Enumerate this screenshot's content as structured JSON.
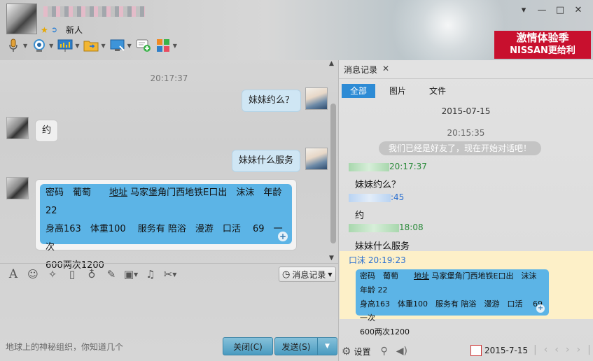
{
  "header": {
    "nickname": "",
    "signature": "新人",
    "window_controls": [
      "▾",
      "—",
      "□",
      "✕"
    ]
  },
  "ad": {
    "line1": "激情体验季",
    "line2": "NISSAN更给利"
  },
  "chat": {
    "timestamp": "20:17:37",
    "messages": [
      {
        "side": "me",
        "text": "妹妹约么？"
      },
      {
        "side": "them",
        "text": "约"
      },
      {
        "side": "me",
        "text": "妹妹什么服务"
      }
    ],
    "card": {
      "line1_a": "密码　葡萄　　",
      "line1_link": "地址",
      "line1_b": " 马家堡角门西地铁E口出　沫沫　年龄 22",
      "line2": "身高163　体重100　 服务有 陪浴　漫游　口活　 69　一次",
      "line3": "600两次1200"
    }
  },
  "input": {
    "history_button": "消息记录",
    "placeholder": "地球上的神秘组织，你知道几个",
    "close_button": "关闭(C)",
    "send_button": "发送(S)"
  },
  "history": {
    "tab_title": "消息记录",
    "filters": [
      "全部",
      "图片",
      "文件"
    ],
    "date": "2015-07-15",
    "time": "20:15:35",
    "system_message": "我们已经是好友了，现在开始对话吧！",
    "entries": [
      {
        "sender_time": "20:17:37",
        "text": "妹妹约么？"
      },
      {
        "sender_time": ":45",
        "text": "约"
      },
      {
        "sender_time": "18:08",
        "text": "妹妹什么服务"
      }
    ],
    "highlight_sender": "口沫 20:19:23",
    "card": {
      "line1_a": "密码　葡萄　　",
      "line1_link": "地址",
      "line1_b": " 马家堡角门西地铁E口出　沫沫　年龄 22",
      "line2": "身高163　体重100　服务有 陪浴　漫游　口活　 69　一次",
      "line3": "600两次1200"
    },
    "settings_label": "设置",
    "date_picker": "2015-7-15"
  }
}
